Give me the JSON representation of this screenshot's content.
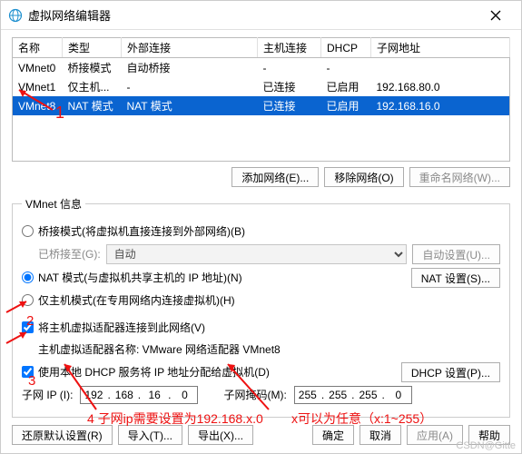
{
  "window": {
    "title": "虚拟网络编辑器"
  },
  "table": {
    "headers": {
      "name": "名称",
      "type": "类型",
      "ext": "外部连接",
      "host": "主机连接",
      "dhcp": "DHCP",
      "subnet": "子网地址"
    },
    "rows": [
      {
        "name": "VMnet0",
        "type": "桥接模式",
        "ext": "自动桥接",
        "host": "-",
        "dhcp": "-",
        "subnet": ""
      },
      {
        "name": "VMnet1",
        "type": "仅主机...",
        "ext": "-",
        "host": "已连接",
        "dhcp": "已启用",
        "subnet": "192.168.80.0"
      },
      {
        "name": "VMnet8",
        "type": "NAT 模式",
        "ext": "NAT 模式",
        "host": "已连接",
        "dhcp": "已启用",
        "subnet": "192.168.16.0"
      }
    ]
  },
  "buttons": {
    "add_net": "添加网络(E)...",
    "remove_net": "移除网络(O)",
    "rename_net": "重命名网络(W)...",
    "auto_set": "自动设置(U)...",
    "nat_set": "NAT 设置(S)...",
    "dhcp_set": "DHCP 设置(P)...",
    "restore": "还原默认设置(R)",
    "import": "导入(T)...",
    "export": "导出(X)...",
    "ok": "确定",
    "cancel": "取消",
    "apply": "应用(A)",
    "help": "帮助"
  },
  "info": {
    "legend": "VMnet 信息",
    "bridge": "桥接模式(将虚拟机直接连接到外部网络)(B)",
    "bridge_to": "已桥接至(G):",
    "bridge_select": "自动",
    "nat": "NAT 模式(与虚拟机共享主机的 IP 地址)(N)",
    "hostonly": "仅主机模式(在专用网络内连接虚拟机)(H)",
    "connect_adapter": "将主机虚拟适配器连接到此网络(V)",
    "adapter_name": "主机虚拟适配器名称: VMware 网络适配器 VMnet8",
    "use_dhcp": "使用本地 DHCP 服务将 IP 地址分配给虚拟机(D)",
    "subnet_ip_label": "子网 IP (I):",
    "subnet_mask_label": "子网掩码(M):",
    "subnet_ip": [
      "192",
      "168",
      "16",
      "0"
    ],
    "subnet_mask": [
      "255",
      "255",
      "255",
      "0"
    ]
  },
  "annotations": {
    "n1": "1",
    "n2": "2",
    "n3": "3",
    "note1": "4 子网ip需要设置为192.168.x.0",
    "note2": "x可以为任意（x:1~255）"
  },
  "chart_data": {
    "type": "table",
    "columns": [
      "名称",
      "类型",
      "外部连接",
      "主机连接",
      "DHCP",
      "子网地址"
    ],
    "rows": [
      [
        "VMnet0",
        "桥接模式",
        "自动桥接",
        "-",
        "-",
        ""
      ],
      [
        "VMnet1",
        "仅主机...",
        "-",
        "已连接",
        "已启用",
        "192.168.80.0"
      ],
      [
        "VMnet8",
        "NAT 模式",
        "NAT 模式",
        "已连接",
        "已启用",
        "192.168.16.0"
      ]
    ],
    "selected_row_index": 2,
    "subnet_ip": "192.168.16.0",
    "subnet_mask": "255.255.255.0"
  },
  "watermark": "CSDN@Gitte"
}
